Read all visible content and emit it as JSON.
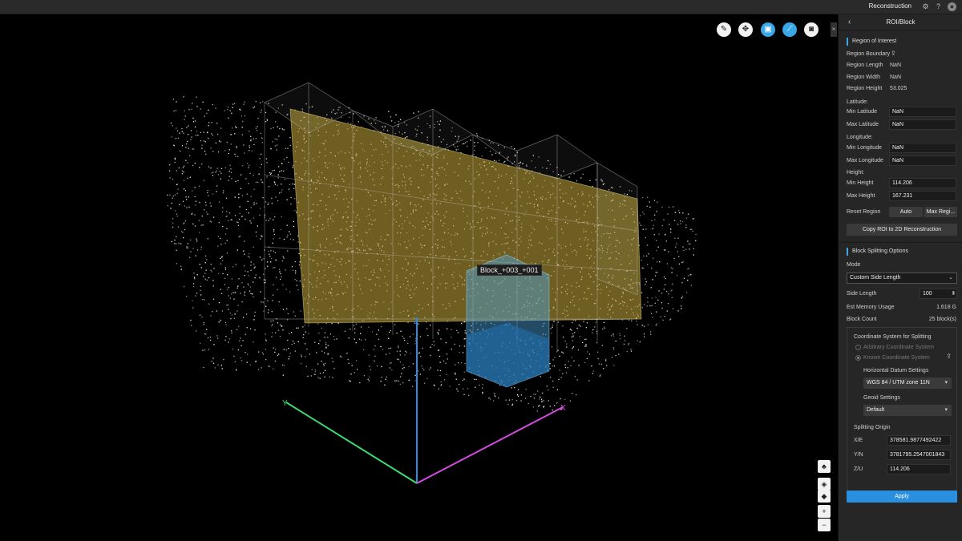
{
  "topbar": {
    "title": "Reconstruction",
    "icons": [
      "gear-icon",
      "help-icon",
      "user-icon"
    ]
  },
  "viewport": {
    "toolbar": [
      {
        "name": "edit-icon",
        "glyph": "✎"
      },
      {
        "name": "move-icon",
        "glyph": "✥"
      },
      {
        "name": "roi-icon",
        "glyph": "▣"
      },
      {
        "name": "measure-icon",
        "glyph": "⟋"
      },
      {
        "name": "camera-icon",
        "glyph": "◙"
      }
    ],
    "collapse_glyph": "»",
    "block_label": "Block_+003_+001",
    "axes": {
      "x": "X",
      "y": "Y",
      "z": "Z"
    },
    "side_controls": {
      "zoom_in": "+",
      "zoom_out": "−"
    }
  },
  "panel": {
    "title": "ROI/Block",
    "back_glyph": "‹",
    "roi": {
      "section": "Region of Interest",
      "boundary_label": "Region Boundary",
      "length_label": "Region Length",
      "length_value": "NaN",
      "width_label": "Region Width",
      "width_value": "NaN",
      "height_label": "Region Height",
      "height_value": "53.025",
      "latitude_group": "Latitude:",
      "min_lat_label": "Min Latitude",
      "min_lat_value": "NaN",
      "max_lat_label": "Max Latitude",
      "max_lat_value": "NaN",
      "longitude_group": "Longitude:",
      "min_lon_label": "Min Longitude",
      "min_lon_value": "NaN",
      "max_lon_label": "Max Longitude",
      "max_lon_value": "NaN",
      "height_group": "Height:",
      "min_h_label": "Min Height",
      "min_h_value": "114.206",
      "max_h_label": "Max Height",
      "max_h_value": "167.231",
      "reset_label": "Reset Region",
      "auto_button": "Auto",
      "max_region_button": "Max Regi...",
      "copy_button": "Copy ROI to 2D Reconstruction"
    },
    "block": {
      "section": "Block Splitting Options",
      "mode_label": "Mode",
      "mode_value": "Custom Side Length",
      "side_length_label": "Side Length",
      "side_length_value": "100",
      "memory_label": "Est Memory Usage",
      "memory_value": "1.618 G",
      "count_label": "Block Count",
      "count_value": "25 block(s)"
    },
    "coords": {
      "title": "Coordinate System for Splitting",
      "arbitrary": "Arbitrary Coordinate System",
      "known": "Known Coordinate System",
      "datum_label": "Horizontal Datum Settings",
      "datum_value": "WGS 84 / UTM zone 11N",
      "geoid_label": "Geoid Settings",
      "geoid_value": "Default",
      "origin_label": "Splitting Origin",
      "xe_label": "X/E",
      "xe_value": "378581.9877492422",
      "yn_label": "Y/N",
      "yn_value": "3781795.2547001843",
      "zu_label": "Z/U",
      "zu_value": "114.206"
    },
    "apply": "Apply"
  },
  "colors": {
    "accent": "#2b8fe0",
    "roi_fill": "#c9ab3c",
    "block_fill": "#3f9bd3",
    "axis_x": "#d44be0",
    "axis_y": "#3ddc73",
    "axis_z": "#2f8de0"
  }
}
